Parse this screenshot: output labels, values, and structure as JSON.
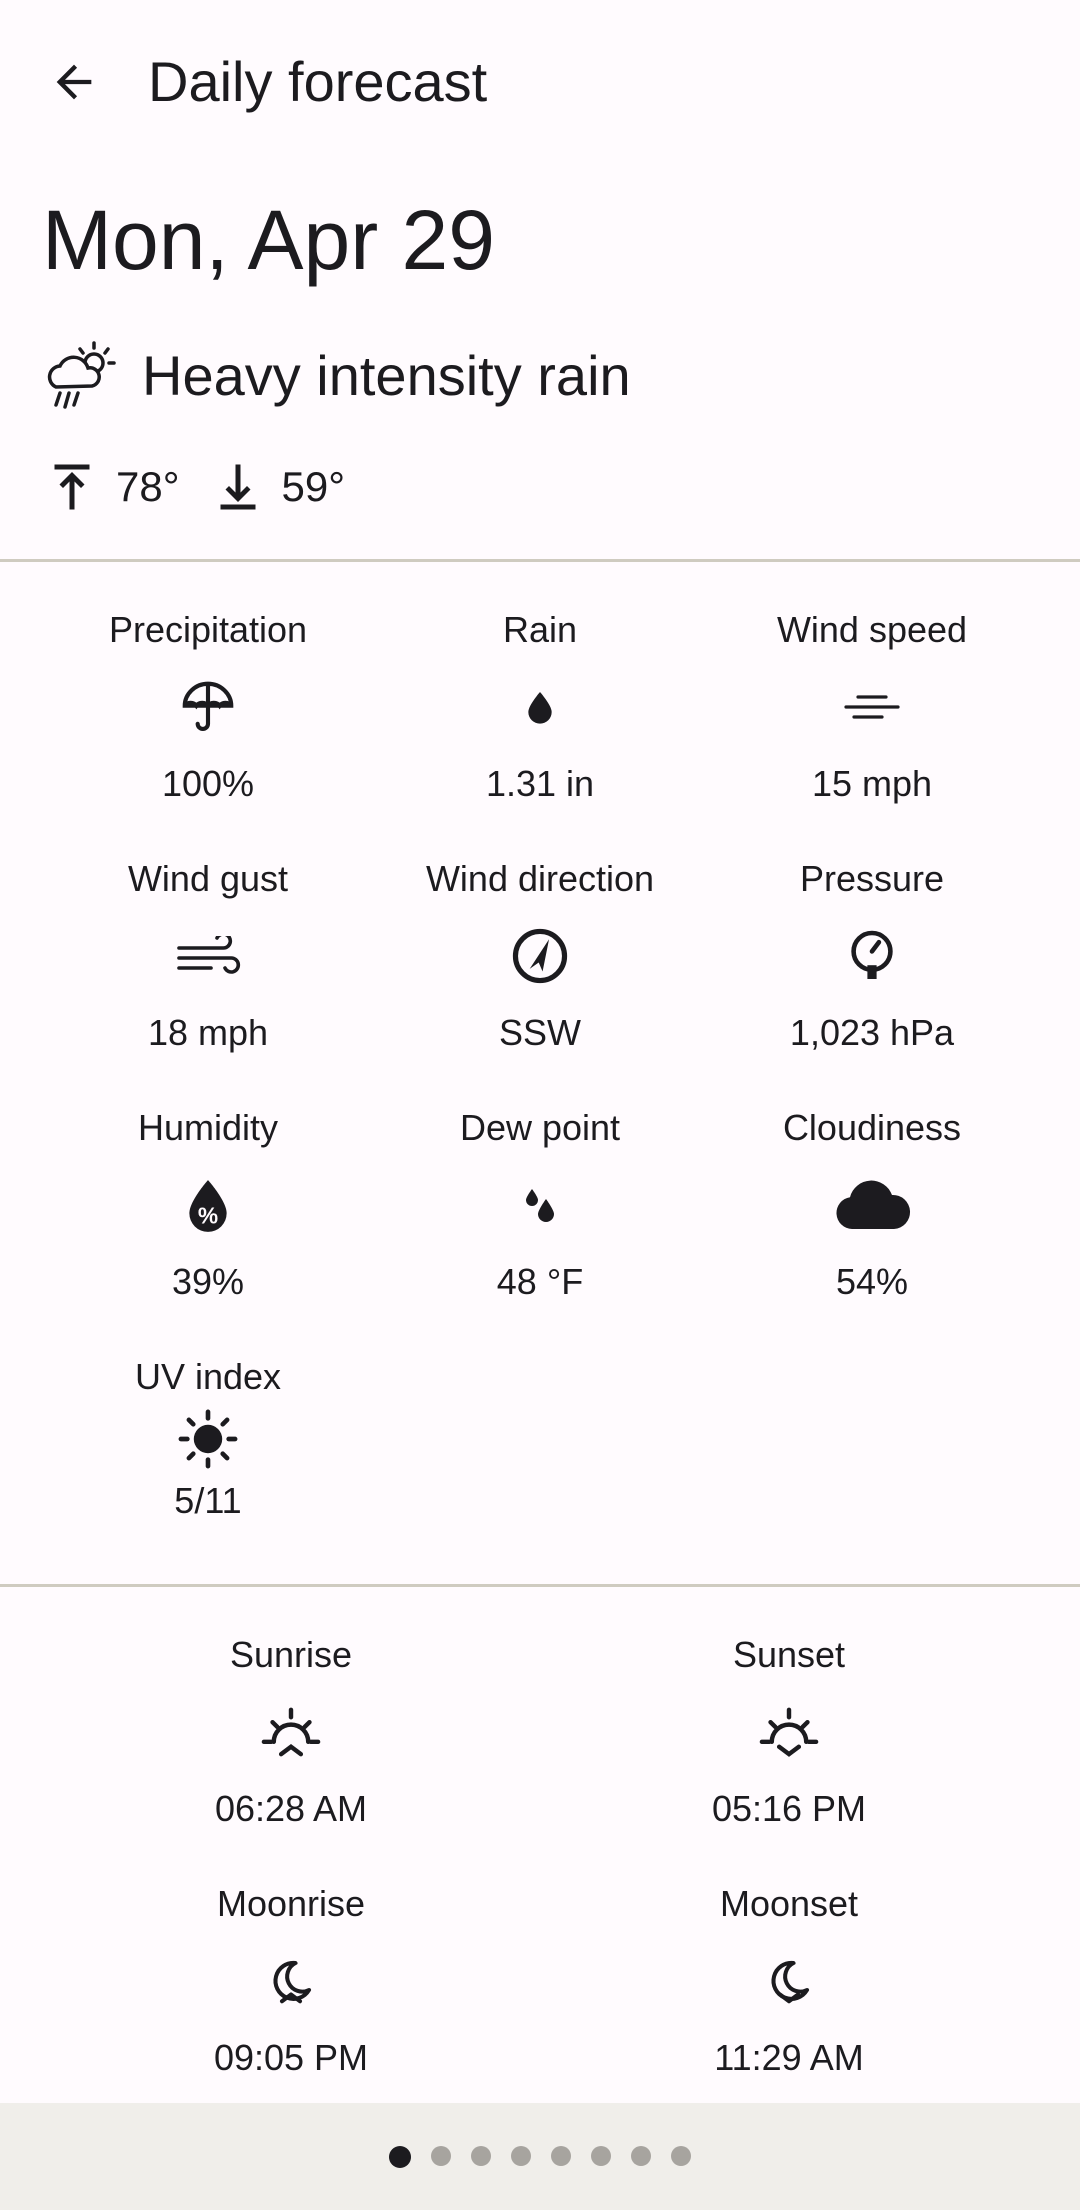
{
  "appbar": {
    "title": "Daily forecast"
  },
  "date": "Mon, Apr 29",
  "condition": {
    "text": "Heavy intensity rain"
  },
  "temps": {
    "high": "78°",
    "low": "59°"
  },
  "details": [
    {
      "label": "Precipitation",
      "value": "100%"
    },
    {
      "label": "Rain",
      "value": "1.31 in"
    },
    {
      "label": "Wind speed",
      "value": "15 mph"
    },
    {
      "label": "Wind gust",
      "value": "18 mph"
    },
    {
      "label": "Wind direction",
      "value": "SSW"
    },
    {
      "label": "Pressure",
      "value": "1,023 hPa"
    },
    {
      "label": "Humidity",
      "value": "39%"
    },
    {
      "label": "Dew point",
      "value": "48 °F"
    },
    {
      "label": "Cloudiness",
      "value": "54%"
    },
    {
      "label": "UV index",
      "value": "5/11"
    }
  ],
  "astro": [
    {
      "label": "Sunrise",
      "value": "06:28 AM"
    },
    {
      "label": "Sunset",
      "value": "05:16 PM"
    },
    {
      "label": "Moonrise",
      "value": "09:05 PM"
    },
    {
      "label": "Moonset",
      "value": "11:29 AM"
    }
  ],
  "pager": {
    "count": 8,
    "active_index": 0
  }
}
